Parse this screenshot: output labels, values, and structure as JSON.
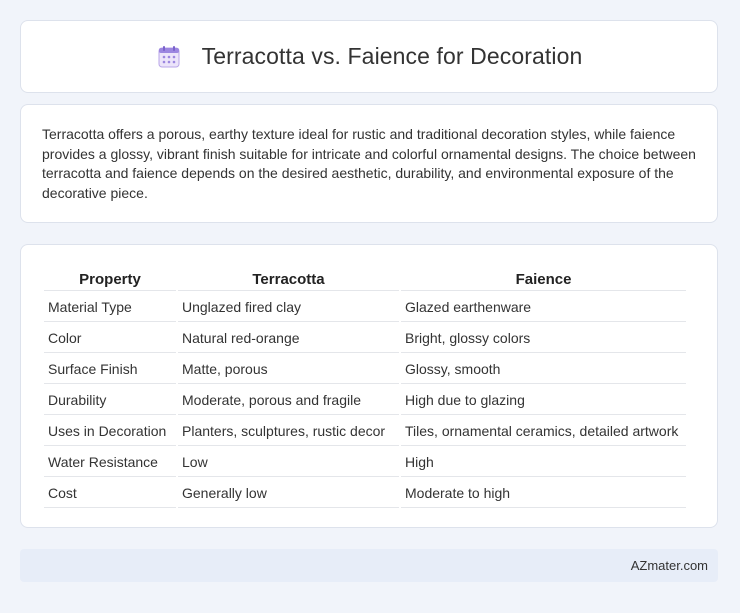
{
  "header": {
    "title": "Terracotta vs. Faience for Decoration",
    "icon": "calendar-icon"
  },
  "intro": {
    "text": "Terracotta offers a porous, earthy texture ideal for rustic and traditional decoration styles, while faience provides a glossy, vibrant finish suitable for intricate and colorful ornamental designs. The choice between terracotta and faience depends on the desired aesthetic, durability, and environmental exposure of the decorative piece."
  },
  "table": {
    "headers": [
      "Property",
      "Terracotta",
      "Faience"
    ],
    "rows": [
      [
        "Material Type",
        "Unglazed fired clay",
        "Glazed earthenware"
      ],
      [
        "Color",
        "Natural red-orange",
        "Bright, glossy colors"
      ],
      [
        "Surface Finish",
        "Matte, porous",
        "Glossy, smooth"
      ],
      [
        "Durability",
        "Moderate, porous and fragile",
        "High due to glazing"
      ],
      [
        "Uses in Decoration",
        "Planters, sculptures, rustic decor",
        "Tiles, ornamental ceramics, detailed artwork"
      ],
      [
        "Water Resistance",
        "Low",
        "High"
      ],
      [
        "Cost",
        "Generally low",
        "Moderate to high"
      ]
    ]
  },
  "footer": {
    "text": "AZmater.com"
  }
}
